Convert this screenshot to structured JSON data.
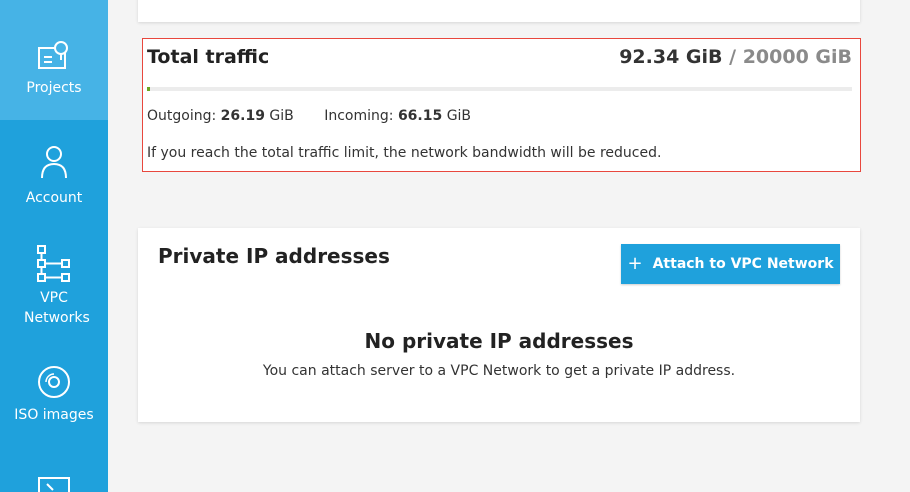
{
  "sidebar": {
    "items": [
      {
        "label": "Projects",
        "icon": "projects-icon",
        "active": true
      },
      {
        "label": "Account",
        "icon": "user-icon"
      },
      {
        "label": "VPC Networks",
        "icon": "network-icon"
      },
      {
        "label": "ISO images",
        "icon": "disc-icon"
      },
      {
        "label": "",
        "icon": "terminal-icon"
      }
    ]
  },
  "traffic": {
    "title": "Total traffic",
    "used": "92.34 GiB",
    "separator": " / ",
    "limit": "20000 GiB",
    "usage_fraction": 0.0046,
    "outgoing_label": "Outgoing:",
    "outgoing_value": "26.19",
    "outgoing_unit": "GiB",
    "incoming_label": "Incoming:",
    "incoming_value": "66.15",
    "incoming_unit": "GiB",
    "note": "If you reach the total traffic limit, the network bandwidth will be reduced."
  },
  "private_ip": {
    "title": "Private IP addresses",
    "attach_button": "Attach to VPC Network",
    "empty_title": "No private IP addresses",
    "empty_text": "You can attach server to a VPC Network to get a private IP address."
  },
  "colors": {
    "sidebar": "#1fa1dc",
    "sidebar_active": "#46b3e6",
    "highlight_border": "#e8473d",
    "progress_fill": "#6aa520",
    "button": "#1fa1dc"
  }
}
